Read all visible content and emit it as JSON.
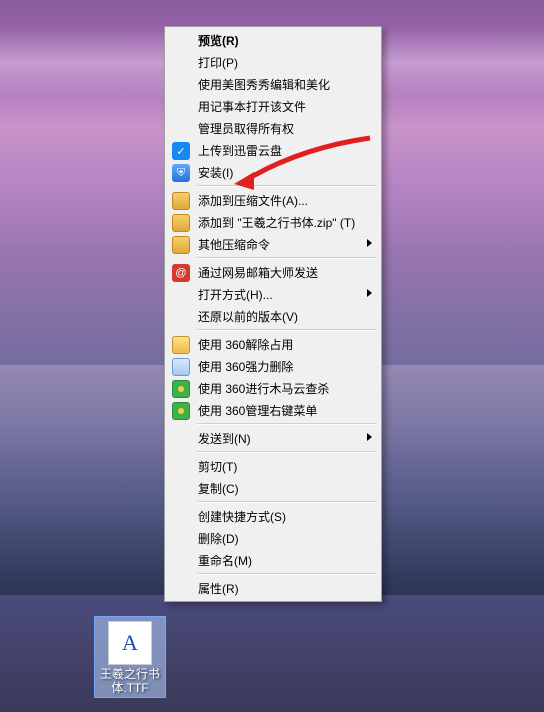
{
  "file": {
    "name": "王羲之行书体.TTF",
    "glyph": "A"
  },
  "menu": [
    [
      {
        "id": "preview",
        "label": "预览(R)",
        "bold": true
      },
      {
        "id": "print",
        "label": "打印(P)"
      },
      {
        "id": "meitu",
        "label": "使用美图秀秀编辑和美化"
      },
      {
        "id": "notepad",
        "label": "用记事本打开该文件"
      },
      {
        "id": "admin-own",
        "label": "管理员取得所有权"
      },
      {
        "id": "xunlei",
        "label": "上传到迅雷云盘",
        "icon": "ic-xunlei",
        "iconText": "✓"
      },
      {
        "id": "install",
        "label": "安装(I)",
        "icon": "ic-shield",
        "iconText": "⛨"
      }
    ],
    [
      {
        "id": "add-archive",
        "label": "添加到压缩文件(A)...",
        "icon": "ic-archive"
      },
      {
        "id": "add-zip",
        "label": "添加到 \"王羲之行书体.zip\" (T)",
        "icon": "ic-archive"
      },
      {
        "id": "other-compress",
        "label": "其他压缩命令",
        "icon": "ic-archive",
        "submenu": true
      }
    ],
    [
      {
        "id": "163mail",
        "label": "通过网易邮箱大师发送",
        "icon": "ic-163",
        "iconText": "@"
      },
      {
        "id": "openwith",
        "label": "打开方式(H)...",
        "submenu": true
      },
      {
        "id": "prev-ver",
        "label": "还原以前的版本(V)"
      }
    ],
    [
      {
        "id": "360-unlock",
        "label": "使用 360解除占用",
        "icon": "ic-folder"
      },
      {
        "id": "360-delete",
        "label": "使用 360强力删除",
        "icon": "ic-shred"
      },
      {
        "id": "360-trojan",
        "label": "使用 360进行木马云查杀",
        "icon": "ic-360"
      },
      {
        "id": "360-menu",
        "label": "使用 360管理右键菜单",
        "icon": "ic-360"
      }
    ],
    [
      {
        "id": "sendto",
        "label": "发送到(N)",
        "submenu": true
      }
    ],
    [
      {
        "id": "cut",
        "label": "剪切(T)"
      },
      {
        "id": "copy",
        "label": "复制(C)"
      }
    ],
    [
      {
        "id": "shortcut",
        "label": "创建快捷方式(S)"
      },
      {
        "id": "delete",
        "label": "删除(D)"
      },
      {
        "id": "rename",
        "label": "重命名(M)"
      }
    ],
    [
      {
        "id": "properties",
        "label": "属性(R)"
      }
    ]
  ]
}
